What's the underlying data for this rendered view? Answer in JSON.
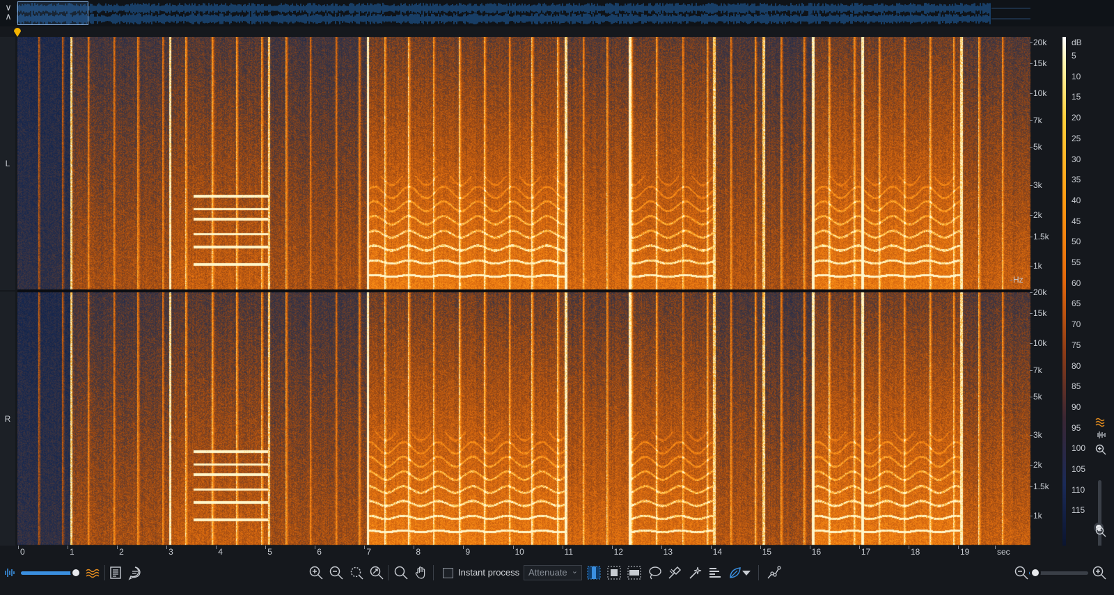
{
  "window": {
    "title": ""
  },
  "channels": {
    "left_label": "L",
    "right_label": "R"
  },
  "frequency_axis": {
    "unit": "Hz",
    "ticks": [
      "20k",
      "15k",
      "10k",
      "7k",
      "5k",
      "3k",
      "2k",
      "1.5k",
      "1k"
    ]
  },
  "db_scale": {
    "unit": "dB",
    "ticks": [
      "5",
      "10",
      "15",
      "20",
      "25",
      "30",
      "35",
      "40",
      "45",
      "50",
      "55",
      "60",
      "65",
      "70",
      "75",
      "80",
      "85",
      "90",
      "95",
      "100",
      "105",
      "110",
      "115"
    ]
  },
  "time_axis": {
    "unit": "sec",
    "ticks": [
      "0",
      "1",
      "2",
      "3",
      "4",
      "5",
      "6",
      "7",
      "8",
      "9",
      "10",
      "11",
      "12",
      "13",
      "14",
      "15",
      "16",
      "17",
      "18",
      "19"
    ]
  },
  "toolbar": {
    "instant_process_label": "Instant process",
    "instant_process_checked": false,
    "mode_value": "Attenuate",
    "opacity_level": 0.93,
    "zoom_level": 0.1
  },
  "colors": {
    "accent": "#3a8fe0",
    "spectrogram_hot": "#ff8c10",
    "spectrogram_cold": "#0f2246",
    "playhead": "#f5b300",
    "background": "#15181d"
  },
  "icons": {
    "collapse": "collapse-expand-icon",
    "waveform": "waveform-icon",
    "spectrogram": "spectrogram-icon",
    "notes": "notes-icon",
    "comments": "comments-icon",
    "zoom_in": "zoom-in-icon",
    "zoom_out": "zoom-out-icon",
    "zoom_selection": "zoom-selection-icon",
    "zoom_fit": "zoom-fit-icon",
    "magnify": "magnify-tool-icon",
    "hand": "hand-tool-icon",
    "time_select": "time-selection-tool-icon",
    "freq_select": "frequency-selection-tool-icon",
    "rect_select": "rectangle-selection-tool-icon",
    "lasso": "lasso-tool-icon",
    "brush": "brush-tool-icon",
    "magic_wand": "magic-wand-tool-icon",
    "harmonic": "harmonic-selection-icon",
    "find_similar": "find-similar-icon",
    "envelope": "envelope-tool-icon"
  }
}
